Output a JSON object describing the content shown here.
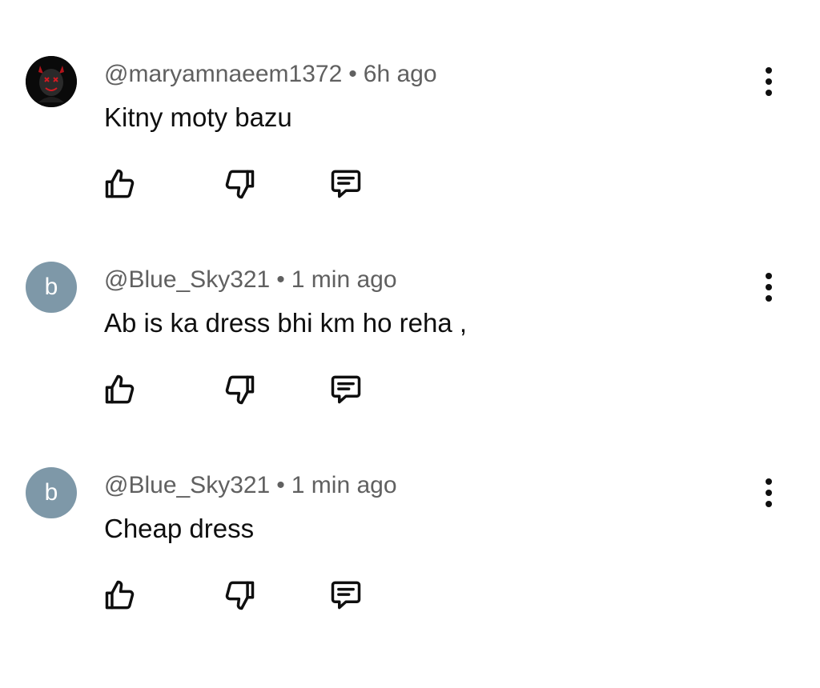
{
  "comments": [
    {
      "avatar": {
        "type": "image",
        "icon": "dark-mask-avatar-icon",
        "color": "#0a0a0a"
      },
      "handle": "@maryamnaeem1372",
      "separator": "•",
      "time": "6h ago",
      "text": "Kitny moty bazu"
    },
    {
      "avatar": {
        "type": "letter",
        "letter": "b",
        "color": "#7e98a8"
      },
      "handle": "@Blue_Sky321",
      "separator": "•",
      "time": "1 min ago",
      "text": "Ab is ka dress bhi km ho reha ,"
    },
    {
      "avatar": {
        "type": "letter",
        "letter": "b",
        "color": "#7e98a8"
      },
      "handle": "@Blue_Sky321",
      "separator": "•",
      "time": "1 min ago",
      "text": "Cheap dress"
    }
  ],
  "icons": {
    "like": "thumb-up-icon",
    "dislike": "thumb-down-icon",
    "reply": "comment-reply-icon",
    "more": "more-vertical-icon"
  }
}
